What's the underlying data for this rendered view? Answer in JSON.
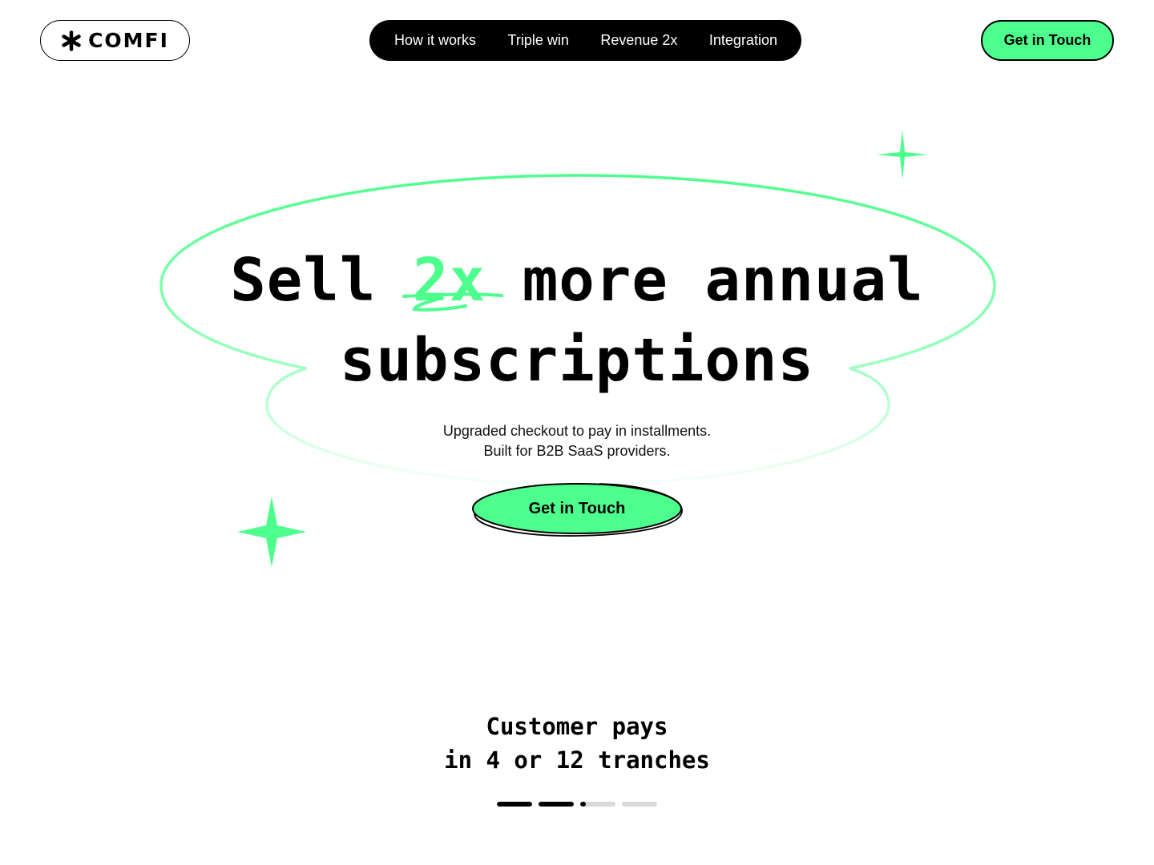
{
  "header": {
    "logo_text": "COMFI",
    "logo_icon": "asterisk-icon",
    "nav": [
      {
        "label": "How it works"
      },
      {
        "label": "Triple win"
      },
      {
        "label": "Revenue 2x"
      },
      {
        "label": "Integration"
      }
    ],
    "cta_label": "Get in Touch"
  },
  "hero": {
    "title_before": "Sell",
    "title_accent": "2x",
    "title_after": "more annual",
    "title_line2": "subscriptions",
    "subtitle_line1": "Upgraded checkout to pay in installments.",
    "subtitle_line2": "Built for B2B SaaS providers.",
    "cta_label": "Get in Touch"
  },
  "feature": {
    "title_line1": "Customer pays",
    "title_line2": "in 4 or 12 tranches",
    "progress": [
      1,
      1,
      0.15,
      0
    ]
  },
  "colors": {
    "accent": "#4dff8c",
    "dark": "#000000",
    "background": "#ffffff"
  },
  "icons": [
    "asterisk-icon",
    "sparkle-icon"
  ]
}
